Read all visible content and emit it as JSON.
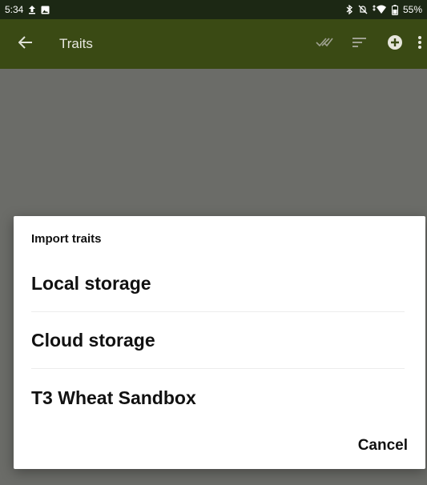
{
  "status_bar": {
    "time": "5:34",
    "battery": "55%",
    "icons": [
      "upload-icon",
      "image-icon",
      "bluetooth-icon",
      "silent-icon",
      "wifi-icon",
      "battery-icon"
    ]
  },
  "app_bar": {
    "title": "Traits",
    "color": "#3a4a14",
    "icons": [
      "back-arrow-icon",
      "check-all-icon",
      "sort-icon",
      "add-circle-icon",
      "more-vert-icon"
    ]
  },
  "dialog": {
    "title": "Import traits",
    "options": [
      "Local storage",
      "Cloud storage",
      "T3 Wheat Sandbox"
    ],
    "cancel_label": "Cancel"
  }
}
